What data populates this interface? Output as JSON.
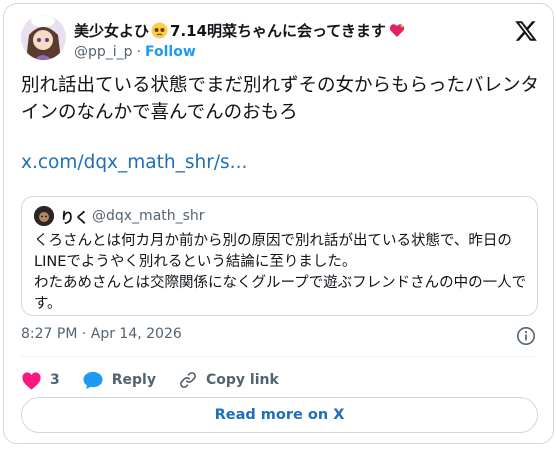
{
  "author": {
    "name_a": "美少女よひ",
    "name_b": "7.14明菜ちゃんに会ってきます",
    "handle": "@pp_i_p",
    "separator": "·",
    "follow_label": "Follow"
  },
  "tweet": {
    "text": "別れ話出ている状態でまだ別れずその女からもらったバレンタインのなんかで喜んでんのおもろ",
    "link": "x.com/dqx_math_shr/s..."
  },
  "quote": {
    "name": "りく",
    "handle": "@dqx_math_shr",
    "line1": "くろさんとは何カ月か前から別の原因で別れ話が出ている状態で、昨日のLINEでようやく別れるという結論に至りました。",
    "line2": "わたあめさんとは交際関係になくグループで遊ぶフレンドさんの中の一人です。"
  },
  "meta": {
    "timestamp": "8:27 PM · Apr 14, 2026"
  },
  "actions": {
    "likes": "3",
    "reply_label": "Reply",
    "copy_label": "Copy link"
  },
  "read_more_label": "Read more on X",
  "icons": {
    "pleading": "pleading-face-emoji",
    "heart_emoji": "sparkling-heart-emoji",
    "logo": "x-logo-icon",
    "like": "heart-icon",
    "reply": "speech-bubble-icon",
    "copy": "link-icon",
    "info": "info-icon"
  },
  "colors": {
    "like": "#f91880",
    "link": "#1d9bf0",
    "secondary": "#536471",
    "border": "#cfd9de"
  }
}
